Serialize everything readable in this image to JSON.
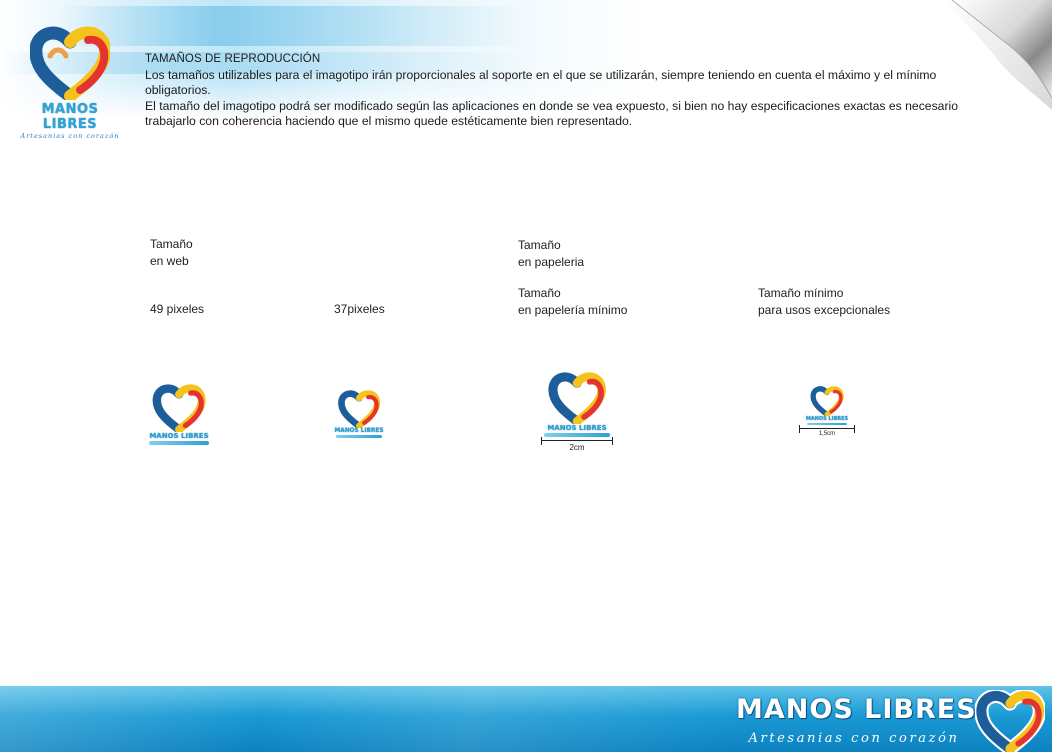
{
  "brand": {
    "name": "MANOS LIBRES",
    "tagline": "Artesanias con corazón",
    "colors": {
      "blue": "#1d5e9a",
      "light_blue": "#2aa6d6",
      "yellow": "#f6c21c",
      "red": "#e3342f",
      "orange": "#f08a1d"
    }
  },
  "intro": {
    "section_title": "TAMAÑOS DE REPRODUCCIÓN",
    "paragraph_1": "Los tamaños utilizables para el imagotipo irán proporcionales al soporte en el que se utilizarán, siempre teniendo en cuenta el máximo y el mínimo obligatorios.",
    "paragraph_2": "El tamaño del imagotipo podrá ser modificado según las aplicaciones en donde se vea expuesto, si bien no hay especificaciones  exactas es necesario trabajarlo con coherencia haciendo que el mismo quede estéticamente bien representado."
  },
  "sizes": {
    "web_heading_1": "Tamaño",
    "web_heading_2": "en web",
    "paper_heading_1": "Tamaño",
    "paper_heading_2": "en papeleria",
    "web_large": "49 pixeles",
    "web_small": "37pixeles",
    "paper_min_1": "Tamaño",
    "paper_min_2": "en papelería mínimo",
    "exceptional_1": "Tamaño mínimo",
    "exceptional_2": "para usos excepcionales",
    "measure_paper": "2cm",
    "measure_exceptional": "1,5cm"
  },
  "icons": [
    "heart-logo-icon",
    "page-curl-icon"
  ]
}
